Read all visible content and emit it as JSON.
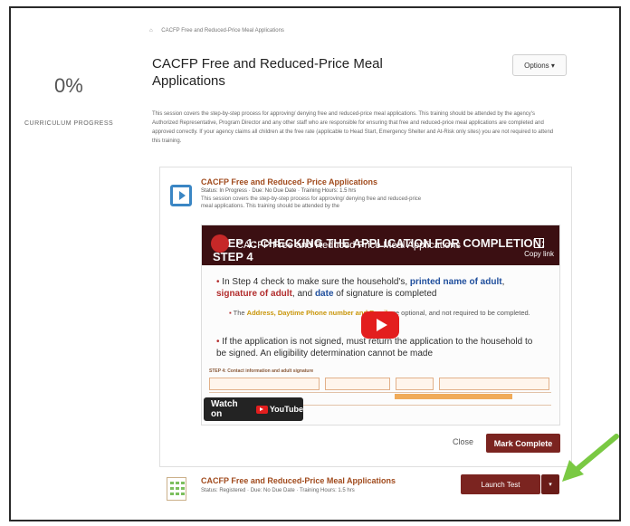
{
  "sidebar": {
    "progress_percent": "0%",
    "progress_label": "CURRICULUM PROGRESS"
  },
  "breadcrumb": {
    "home_icon": "home-icon",
    "current": "CACFP Free and Reduced-Price Meal Applications"
  },
  "header": {
    "title": "CACFP Free and Reduced-Price Meal Applications",
    "options_label": "Options ▾"
  },
  "description": "This session covers the step-by-step process for approving/ denying free and reduced-price meal applications. This training should be attended by the agency's Authorized Representative, Program Director and any other staff who are responsible for ensuring that free and reduced-price meal applications are completed and approved correctly. If your agency claims all children at the free rate (applicable to Head Start, Emergency Shelter and At-Risk only sites) you are not required to attend this training.",
  "module": {
    "icon": "video-play-icon",
    "title": "CACFP Free and Reduced- Price Applications",
    "status": "Status: In Progress · Due: No Due Date · Training Hours: 1.5 hrs",
    "description": "This session covers the step-by-step process for approving/ denying free and reduced-price meal applications. This training should be attended by the",
    "video": {
      "yt_title": "CACFP Free and Reduced Price Meal Applications",
      "slide_title": "STEP 1: CHECKING THE APPLICATION FOR COMPLETION: STEP 4",
      "copy_link": "Copy link",
      "bullet1_pre": "In Step 4 check to make sure the household's,",
      "bullet1_hl1": "printed name of adult",
      "bullet1_comma": ",",
      "bullet1_hl2": "signature of adult",
      "bullet1_mid": ", and",
      "bullet1_hl3": "date",
      "bullet1_post": "of signature is completed",
      "sub_pre": "The",
      "sub_hl": "Address, Daytime Phone number and Email",
      "sub_post": "are optional, and not required to be completed.",
      "bullet2": "If the application is not signed, must return the application to the household to be signed. An eligibility determination cannot be made",
      "form_label": "STEP 4: Contact information and adult signature",
      "watch_on": "Watch on",
      "youtube": "YouTube"
    },
    "close_label": "Close",
    "mark_complete_label": "Mark Complete"
  },
  "test": {
    "icon": "test-grid-icon",
    "title": "CACFP Free and Reduced-Price Meal Applications",
    "status": "Status: Registered · Due: No Due Date · Training Hours: 1.5 hrs",
    "launch_label": "Launch Test",
    "caret": "▾"
  },
  "colors": {
    "accent": "#7b2420",
    "title_link": "#a04a1c",
    "annotation_arrow": "#7ac943"
  }
}
